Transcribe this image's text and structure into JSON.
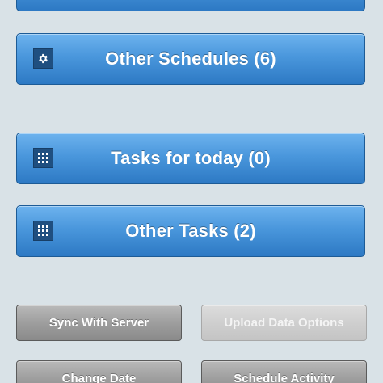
{
  "menu": {
    "other_schedules": {
      "label": "Other Schedules (6)",
      "icon": "gear-icon"
    },
    "tasks_today": {
      "label": "Tasks for today (0)",
      "icon": "grid-icon"
    },
    "other_tasks": {
      "label": "Other Tasks (2)",
      "icon": "grid-icon"
    }
  },
  "actions": {
    "sync": "Sync With Server",
    "upload": "Upload Data Options",
    "change_date": "Change Date",
    "schedule_activity": "Schedule Activity"
  },
  "colors": {
    "background": "#d9e2e7",
    "primary_button": "#4a97dc",
    "secondary_button": "#9e9e9e",
    "disabled_button": "#cfcfcf"
  }
}
